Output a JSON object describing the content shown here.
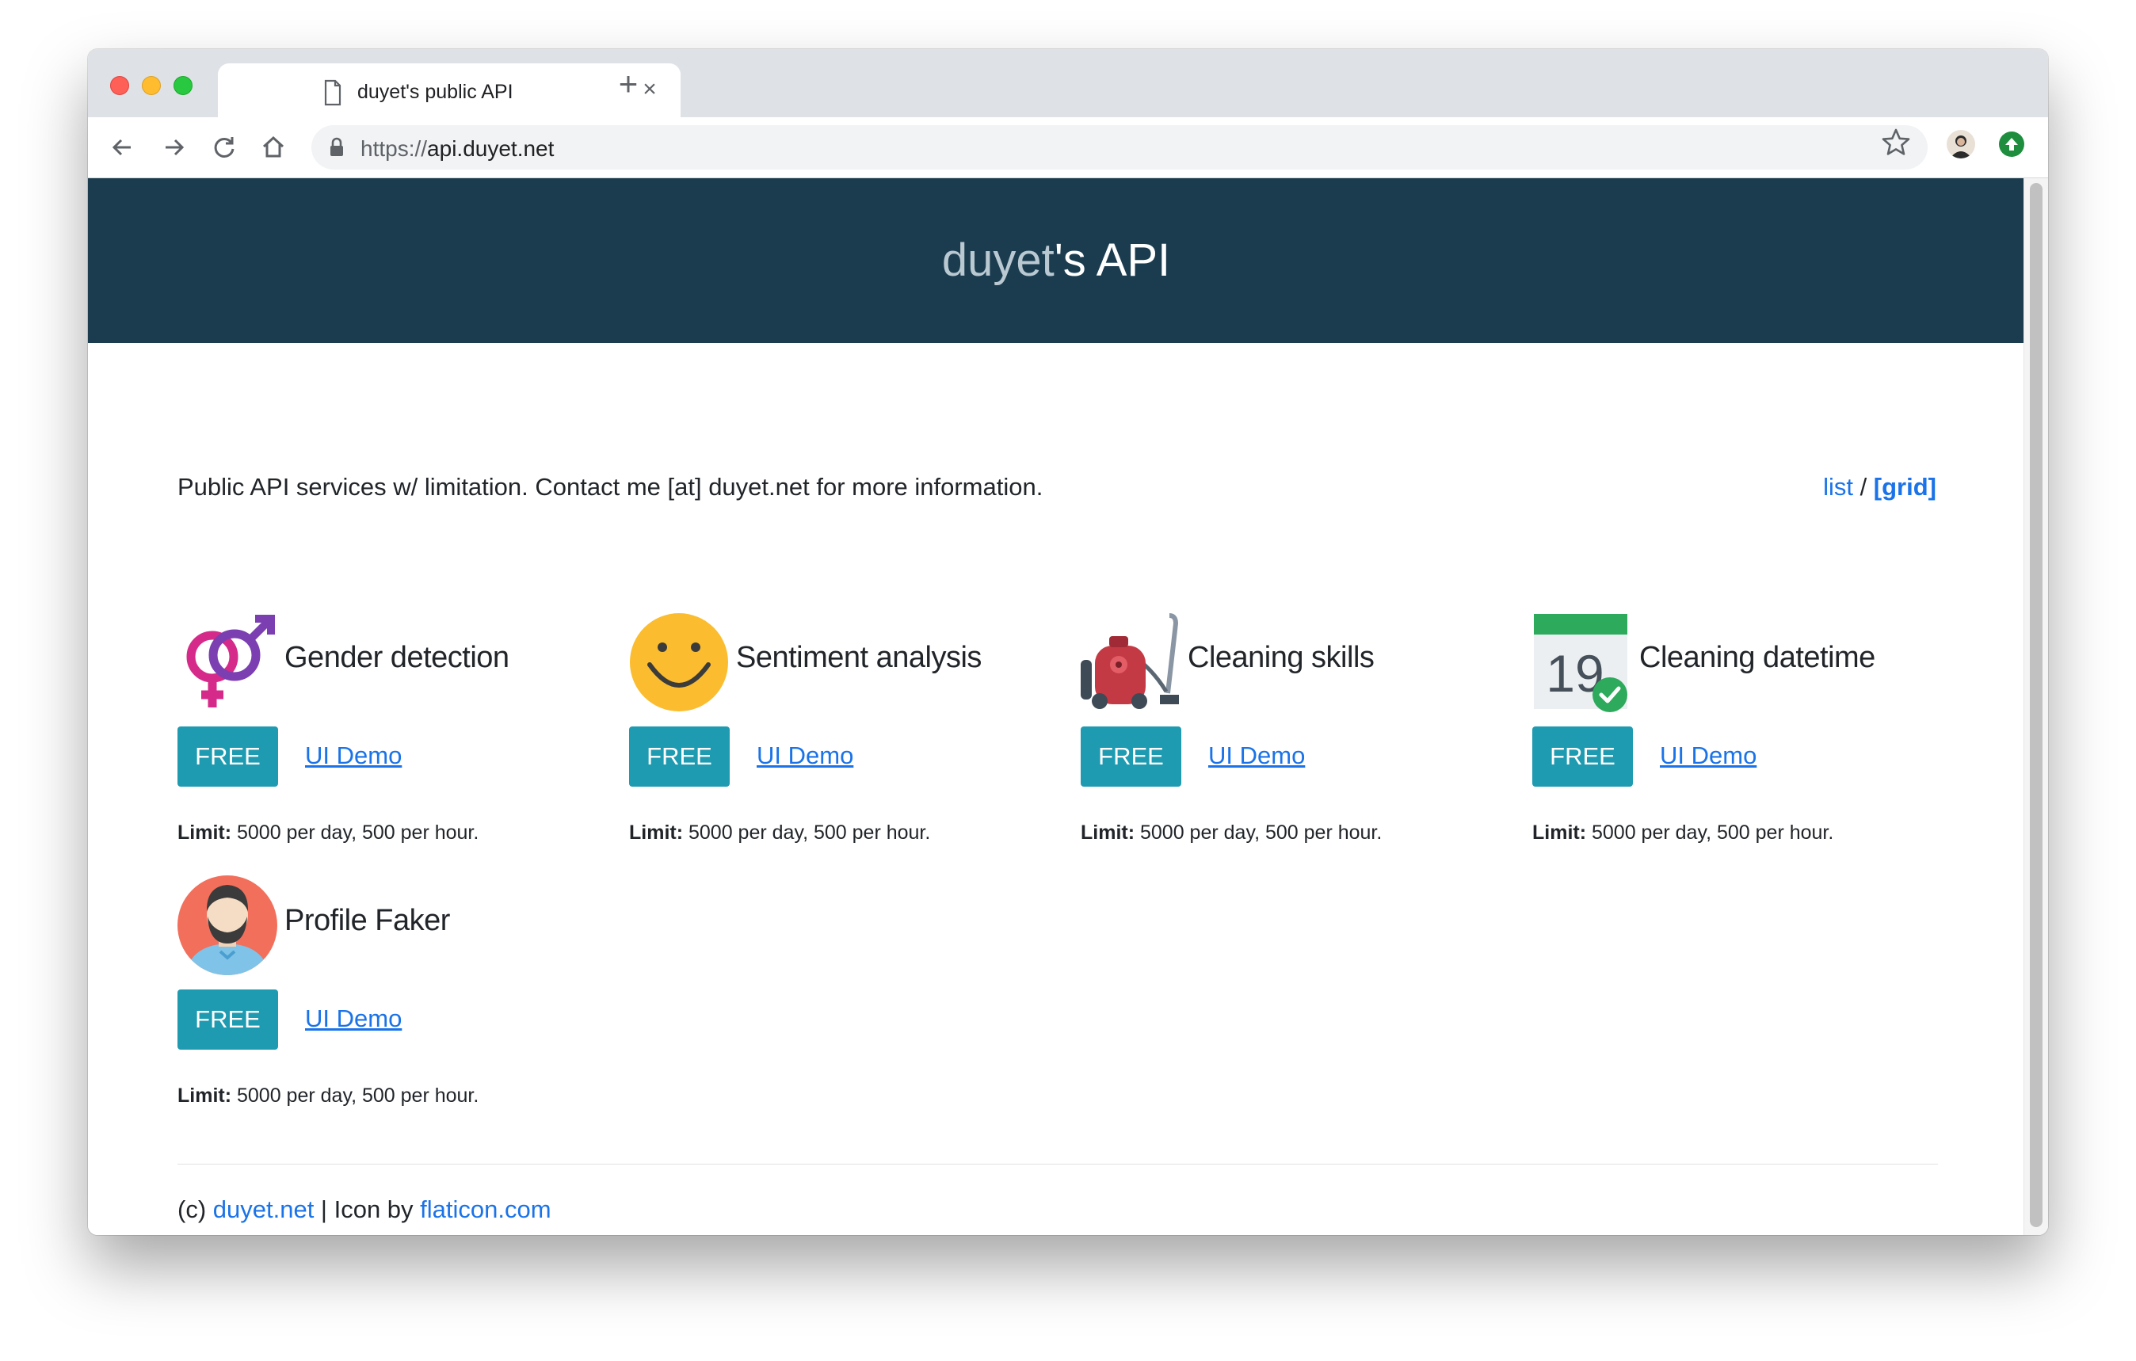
{
  "browser": {
    "tab_title": "duyet's public API",
    "url_scheme": "https://",
    "url_host": "api.duyet.net",
    "new_tab_symbol": "+",
    "close_symbol": "×"
  },
  "header": {
    "title_muted": "duyet",
    "title_rest": "'s API",
    "bg_color": "#1b3c4f"
  },
  "intro": {
    "text": "Public API services w/ limitation. Contact me [at] duyet.net for more information."
  },
  "view_switch": {
    "list_label": "list",
    "separator": " / ",
    "grid_label": "[grid]"
  },
  "cards": [
    {
      "title": "Gender detection",
      "icon": "gender-symbols-icon",
      "badge": "FREE",
      "demo_label": "UI Demo",
      "limit_label": "Limit:",
      "limit_text": " 5000 per day, 500 per hour."
    },
    {
      "title": "Sentiment analysis",
      "icon": "smiley-face-icon",
      "badge": "FREE",
      "demo_label": "UI Demo",
      "limit_label": "Limit:",
      "limit_text": " 5000 per day, 500 per hour."
    },
    {
      "title": "Cleaning skills",
      "icon": "vacuum-cleaner-icon",
      "badge": "FREE",
      "demo_label": "UI Demo",
      "limit_label": "Limit:",
      "limit_text": " 5000 per day, 500 per hour."
    },
    {
      "title": "Cleaning datetime",
      "icon": "calendar-check-icon",
      "badge": "FREE",
      "demo_label": "UI Demo",
      "limit_label": "Limit:",
      "limit_text": " 5000 per day, 500 per hour."
    },
    {
      "title": "Profile Faker",
      "icon": "profile-avatar-icon",
      "badge": "FREE",
      "demo_label": "UI Demo",
      "limit_label": "Limit:",
      "limit_text": " 5000 per day, 500 per hour."
    }
  ],
  "calendar_day": "19",
  "footer": {
    "copyright": "(c) ",
    "site_link": "duyet.net",
    "middle": " | Icon by ",
    "icon_link": "flaticon.com"
  },
  "colors": {
    "accent_button": "#1f9bb1",
    "link": "#1a73e8"
  }
}
